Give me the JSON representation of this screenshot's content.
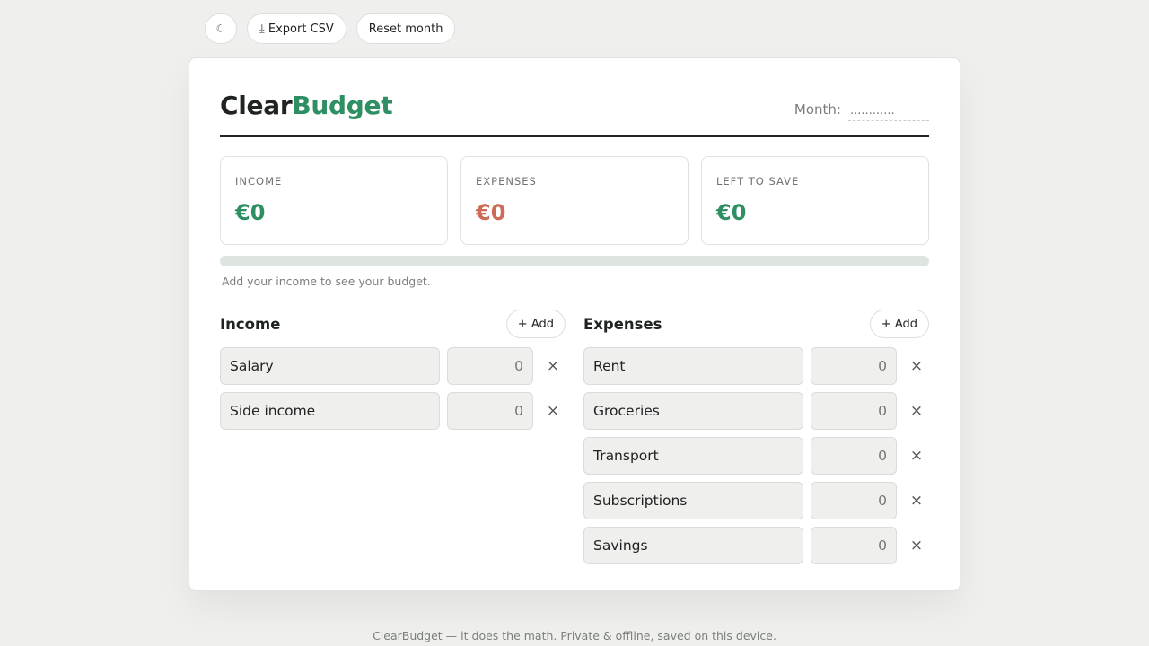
{
  "toolbar": {
    "theme_icon": "☾",
    "export_label": "⤓ Export CSV",
    "reset_label": "Reset month"
  },
  "header": {
    "logo_part1": "Clear",
    "logo_part2": "Budget",
    "month_label": "Month:",
    "month_value": "",
    "month_placeholder": "............"
  },
  "stats": [
    {
      "label": "INCOME",
      "value": "€0"
    },
    {
      "label": "EXPENSES",
      "value": "€0"
    },
    {
      "label": "LEFT TO SAVE",
      "value": "€0"
    }
  ],
  "progress": {
    "fraction": 0
  },
  "hint": "Add your income to see your budget.",
  "income": {
    "title": "Income",
    "add_label": "+ Add",
    "rows": [
      {
        "name": "Salary",
        "amount": "0"
      },
      {
        "name": "Side income",
        "amount": "0"
      }
    ]
  },
  "expenses": {
    "title": "Expenses",
    "add_label": "+ Add",
    "rows": [
      {
        "name": "Rent",
        "amount": "0"
      },
      {
        "name": "Groceries",
        "amount": "0"
      },
      {
        "name": "Transport",
        "amount": "0"
      },
      {
        "name": "Subscriptions",
        "amount": "0"
      },
      {
        "name": "Savings",
        "amount": "0"
      }
    ]
  },
  "remove_symbol": "×",
  "footer": "ClearBudget — it does the math. Private & offline, saved on this device.",
  "colors": {
    "accent": "#2e8f62",
    "expense": "#cc6b56",
    "background": "#eff0ee"
  }
}
